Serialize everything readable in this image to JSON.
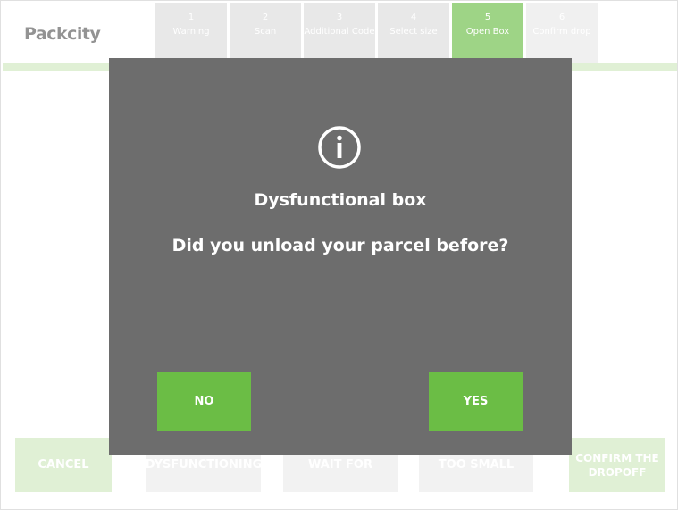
{
  "logo": {
    "text": "Packcity",
    "subtitle": ""
  },
  "steps": [
    {
      "num": "1",
      "label": "Warning"
    },
    {
      "num": "2",
      "label": "Scan"
    },
    {
      "num": "3",
      "label": "Additional Code"
    },
    {
      "num": "4",
      "label": "Select size"
    },
    {
      "num": "5",
      "label": "Open Box"
    },
    {
      "num": "6",
      "label": "Confirm drop"
    }
  ],
  "bottom": {
    "cancel": "CANCEL",
    "dysfunctional": "DYSFUNCTIONING",
    "wait": "WAIT FOR",
    "box_too_small": "TOO SMALL",
    "confirm": "CONFIRM THE DROPOFF"
  },
  "modal": {
    "title": "Dysfunctional box",
    "question": "Did you unload your parcel before?",
    "no_label": "NO",
    "yes_label": "YES",
    "icon": "info-circle-icon"
  },
  "colors": {
    "accent": "#6bbd45",
    "modal_bg": "#6d6d6d"
  }
}
